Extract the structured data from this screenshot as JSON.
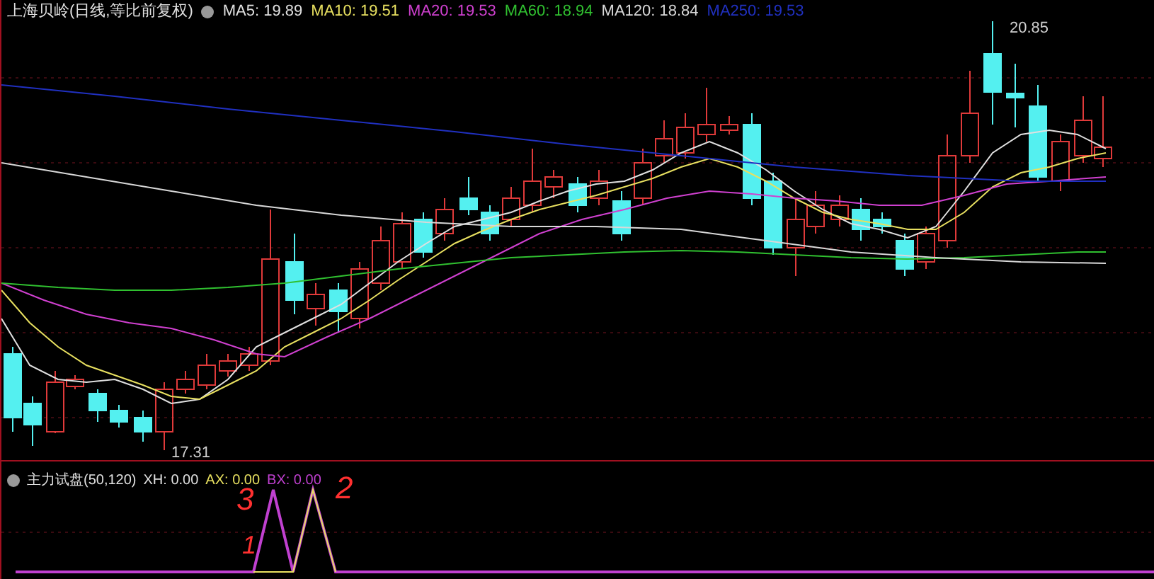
{
  "main_chart": {
    "title": "上海贝岭(日线,等比前复权)",
    "legend": [
      {
        "label": "MA5: 19.89",
        "color": "#e0e0e0"
      },
      {
        "label": "MA10: 19.51",
        "color": "#e8e060"
      },
      {
        "label": "MA20: 19.53",
        "color": "#d040d0"
      },
      {
        "label": "MA60: 18.94",
        "color": "#30c030"
      },
      {
        "label": "MA120: 18.84",
        "color": "#d8d8d8"
      },
      {
        "label": "MA250: 19.53",
        "color": "#2030c0"
      }
    ],
    "high_label": "20.85",
    "low_label": "17.31"
  },
  "indicator": {
    "title": "主力试盘(50,120)",
    "legend": [
      {
        "label": "XH: 0.00",
        "color": "#e0e0e0"
      },
      {
        "label": "AX: 0.00",
        "color": "#e8e060"
      },
      {
        "label": "BX: 0.00",
        "color": "#c040d0"
      }
    ],
    "annotations": [
      {
        "text": "3",
        "color": "#ff3030"
      },
      {
        "text": "1",
        "color": "#ff3030"
      },
      {
        "text": "2",
        "color": "#ff3030"
      }
    ]
  }
}
